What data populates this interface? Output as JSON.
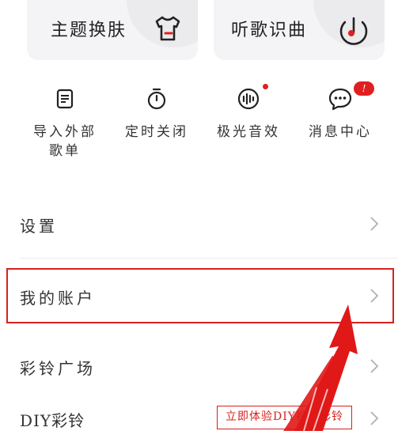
{
  "cards": [
    {
      "label": "主题换肤",
      "icon": "tshirt-icon"
    },
    {
      "label": "听歌识曲",
      "icon": "music-note-icon"
    }
  ],
  "shortcuts": [
    {
      "label": "导入外部歌单",
      "icon": "import-list-icon"
    },
    {
      "label": "定时关闭",
      "icon": "timer-icon"
    },
    {
      "label": "极光音效",
      "icon": "audio-wave-icon"
    },
    {
      "label": "消息中心",
      "icon": "chat-bubble-icon",
      "badge": "!"
    }
  ],
  "menu": [
    {
      "label": "设置"
    },
    {
      "label": "我的账户"
    },
    {
      "label": "彩铃广场"
    },
    {
      "label": "DIY彩铃",
      "promo": "立即体验DIY视频彩铃"
    }
  ],
  "colors": {
    "accent": "#e02020",
    "highlight": "#d9201e",
    "card_bg": "#f4f4f6"
  }
}
